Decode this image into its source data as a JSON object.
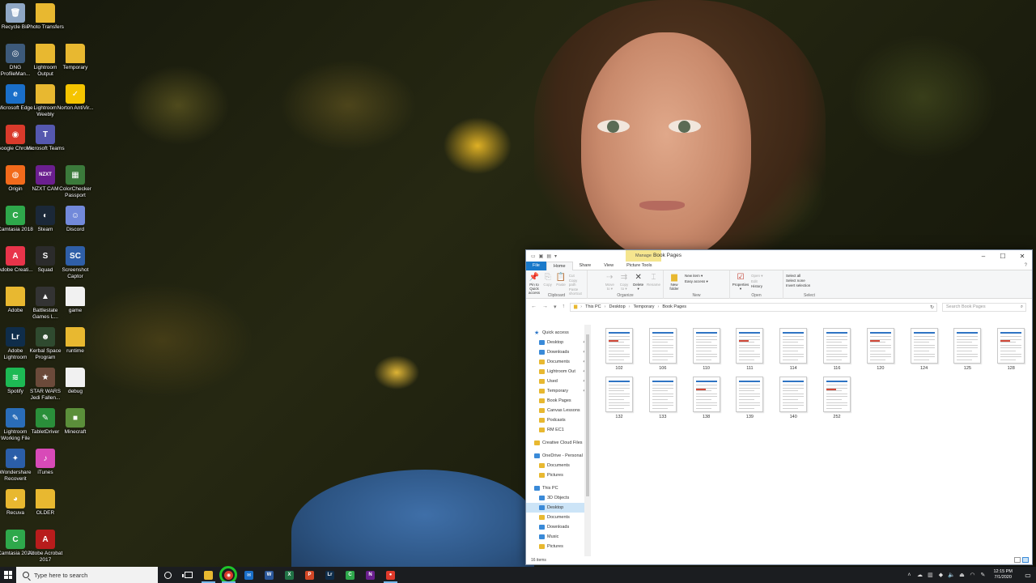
{
  "desktop": {
    "icons": [
      {
        "label": "Recycle Bin",
        "glyph": "🗑",
        "color": "#8fa7c4"
      },
      {
        "label": "Photo Transfers",
        "glyph": "",
        "color": "#e8b830"
      },
      {
        "label": "DNG ProfileMan...",
        "glyph": "◎",
        "color": "#3d5a7a"
      },
      {
        "label": "Lightroom Output",
        "glyph": "",
        "color": "#e8b830"
      },
      {
        "label": "Temporary",
        "glyph": "",
        "color": "#e8b830"
      },
      {
        "label": "Microsoft Edge",
        "glyph": "e",
        "color": "#1a6fc9"
      },
      {
        "label": "Lightroom Weebly",
        "glyph": "",
        "color": "#e8b830"
      },
      {
        "label": "Norton AntiVir...",
        "glyph": "✓",
        "color": "#f5c400"
      },
      {
        "label": "Google Chrome",
        "glyph": "◉",
        "color": "#d93a2b"
      },
      {
        "label": "Microsoft Teams",
        "glyph": "T",
        "color": "#5558af"
      },
      {
        "label": "Origin",
        "glyph": "◍",
        "color": "#f26a1b"
      },
      {
        "label": "NZXT CAM",
        "glyph": "NZXT",
        "color": "#6b1f8f"
      },
      {
        "label": "ColorChecker Passport",
        "glyph": "▦",
        "color": "#3b7a3b"
      },
      {
        "label": "Camtasia 2018",
        "glyph": "C",
        "color": "#2ea84b"
      },
      {
        "label": "Steam",
        "glyph": "◐",
        "color": "#1b2838"
      },
      {
        "label": "Discord",
        "glyph": "☺",
        "color": "#7289da"
      },
      {
        "label": "Adobe Creati...",
        "glyph": "A",
        "color": "#e8344a"
      },
      {
        "label": "Squad",
        "glyph": "S",
        "color": "#2b2b2b"
      },
      {
        "label": "Screenshot Captor",
        "glyph": "SC",
        "color": "#2f5fa8"
      },
      {
        "label": "Adobe",
        "glyph": "",
        "color": "#e8b830"
      },
      {
        "label": "Battlestate Games L...",
        "glyph": "▲",
        "color": "#333333"
      },
      {
        "label": "game",
        "glyph": "",
        "color": "#f1f1f1"
      },
      {
        "label": "Adobe Lightroom",
        "glyph": "Lr",
        "color": "#0f2d4a"
      },
      {
        "label": "Kerbal Space Program",
        "glyph": "☻",
        "color": "#2f4a2f"
      },
      {
        "label": "runtime",
        "glyph": "",
        "color": "#e8b830"
      },
      {
        "label": "Spotify",
        "glyph": "≋",
        "color": "#1db954"
      },
      {
        "label": "STAR WARS Jedi Fallen...",
        "glyph": "★",
        "color": "#6b4a3a"
      },
      {
        "label": "debug",
        "glyph": "",
        "color": "#f1f1f1"
      },
      {
        "label": "Lightroom Working File",
        "glyph": "✎",
        "color": "#2a6db8"
      },
      {
        "label": "TabletDriver",
        "glyph": "✎",
        "color": "#2a8f3a"
      },
      {
        "label": "Minecraft",
        "glyph": "■",
        "color": "#5b8f3a"
      },
      {
        "label": "Wondershare Recoverit",
        "glyph": "✦",
        "color": "#2b5ea8"
      },
      {
        "label": "iTunes",
        "glyph": "♪",
        "color": "#d84ab8"
      },
      {
        "label": "Recuva",
        "glyph": "◕",
        "color": "#e8b830"
      },
      {
        "label": "OLDER",
        "glyph": "",
        "color": "#e8b830"
      },
      {
        "label": "Camtasia 2020",
        "glyph": "C",
        "color": "#2ea84b"
      },
      {
        "label": "Adobe Acrobat 2017",
        "glyph": "A",
        "color": "#b81c1c"
      }
    ]
  },
  "explorer": {
    "manage_tab": "Manage",
    "title": "Book Pages",
    "tabs": [
      "File",
      "Home",
      "Share",
      "View",
      "Picture Tools"
    ],
    "ribbon": {
      "clipboard": {
        "pin": "Pin to Quick access",
        "copy": "Copy",
        "paste": "Paste",
        "cut": "Cut",
        "copy_path": "Copy path",
        "paste_shortcut": "Paste shortcut",
        "group": "Clipboard"
      },
      "organize": {
        "move_to": "Move to ▾",
        "copy_to": "Copy to ▾",
        "delete": "Delete ▾",
        "rename": "Rename",
        "group": "Organize"
      },
      "new": {
        "new_folder": "New folder",
        "new_item": "New item ▾",
        "easy_access": "Easy access ▾",
        "group": "New"
      },
      "open": {
        "properties": "Properties ▾",
        "open": "Open ▾",
        "edit": "Edit",
        "history": "History",
        "group": "Open"
      },
      "select": {
        "select_all": "Select all",
        "select_none": "Select none",
        "invert": "Invert selection",
        "group": "Select"
      }
    },
    "address": {
      "segments": [
        "This PC",
        "Desktop",
        "Temporary",
        "Book Pages"
      ],
      "search_placeholder": "Search Book Pages"
    },
    "nav": [
      {
        "label": "Quick access",
        "type": "star",
        "indent": 0
      },
      {
        "label": "Desktop",
        "type": "blue",
        "indent": 1,
        "pin": true
      },
      {
        "label": "Downloads",
        "type": "blue",
        "indent": 1,
        "pin": true
      },
      {
        "label": "Documents",
        "type": "folder",
        "indent": 1,
        "pin": true
      },
      {
        "label": "Lightroom Out",
        "type": "folder",
        "indent": 1,
        "pin": true
      },
      {
        "label": "Used",
        "type": "folder",
        "indent": 1,
        "pin": true
      },
      {
        "label": "Temporary",
        "type": "folder",
        "indent": 1,
        "pin": true
      },
      {
        "label": "Book Pages",
        "type": "folder",
        "indent": 1
      },
      {
        "label": "Canvas Lessons",
        "type": "folder",
        "indent": 1
      },
      {
        "label": "Podcasts",
        "type": "folder",
        "indent": 1
      },
      {
        "label": "RM EC1",
        "type": "folder",
        "indent": 1
      },
      {
        "label": "",
        "type": "gap",
        "indent": 0
      },
      {
        "label": "Creative Cloud Files",
        "type": "folder",
        "indent": 0
      },
      {
        "label": "",
        "type": "gap",
        "indent": 0
      },
      {
        "label": "OneDrive - Personal",
        "type": "blue",
        "indent": 0
      },
      {
        "label": "Documents",
        "type": "folder",
        "indent": 1
      },
      {
        "label": "Pictures",
        "type": "folder",
        "indent": 1
      },
      {
        "label": "",
        "type": "gap",
        "indent": 0
      },
      {
        "label": "This PC",
        "type": "blue",
        "indent": 0
      },
      {
        "label": "3D Objects",
        "type": "blue",
        "indent": 1
      },
      {
        "label": "Desktop",
        "type": "blue",
        "indent": 1,
        "selected": true
      },
      {
        "label": "Documents",
        "type": "folder",
        "indent": 1
      },
      {
        "label": "Downloads",
        "type": "blue",
        "indent": 1
      },
      {
        "label": "Music",
        "type": "blue",
        "indent": 1
      },
      {
        "label": "Pictures",
        "type": "folder",
        "indent": 1
      }
    ],
    "files": [
      "102",
      "106",
      "110",
      "111",
      "114",
      "116",
      "120",
      "124",
      "125",
      "128",
      "132",
      "133",
      "138",
      "139",
      "140",
      "252"
    ],
    "status": "16 items"
  },
  "taskbar": {
    "search_placeholder": "Type here to search",
    "time": "12:15 PM",
    "date": "7/1/2020",
    "pinned": [
      {
        "name": "file-explorer",
        "glyph": "",
        "color": "#e8b830",
        "open": true
      },
      {
        "name": "chrome",
        "glyph": "◉",
        "color": "#d93a2b",
        "open": true,
        "highlight": true
      },
      {
        "name": "mail",
        "glyph": "✉",
        "color": "#1a6fc9",
        "open": false
      },
      {
        "name": "word",
        "glyph": "W",
        "color": "#2b579a",
        "open": false
      },
      {
        "name": "excel",
        "glyph": "X",
        "color": "#217346",
        "open": false
      },
      {
        "name": "powerpoint",
        "glyph": "P",
        "color": "#d24726",
        "open": false
      },
      {
        "name": "lightroom",
        "glyph": "Lr",
        "color": "#0f2d4a",
        "open": false
      },
      {
        "name": "camtasia",
        "glyph": "C",
        "color": "#2ea84b",
        "open": false
      },
      {
        "name": "nzxt",
        "glyph": "N",
        "color": "#6b1f8f",
        "open": false
      },
      {
        "name": "recorder",
        "glyph": "●",
        "color": "#e03a2b",
        "open": true
      }
    ]
  }
}
